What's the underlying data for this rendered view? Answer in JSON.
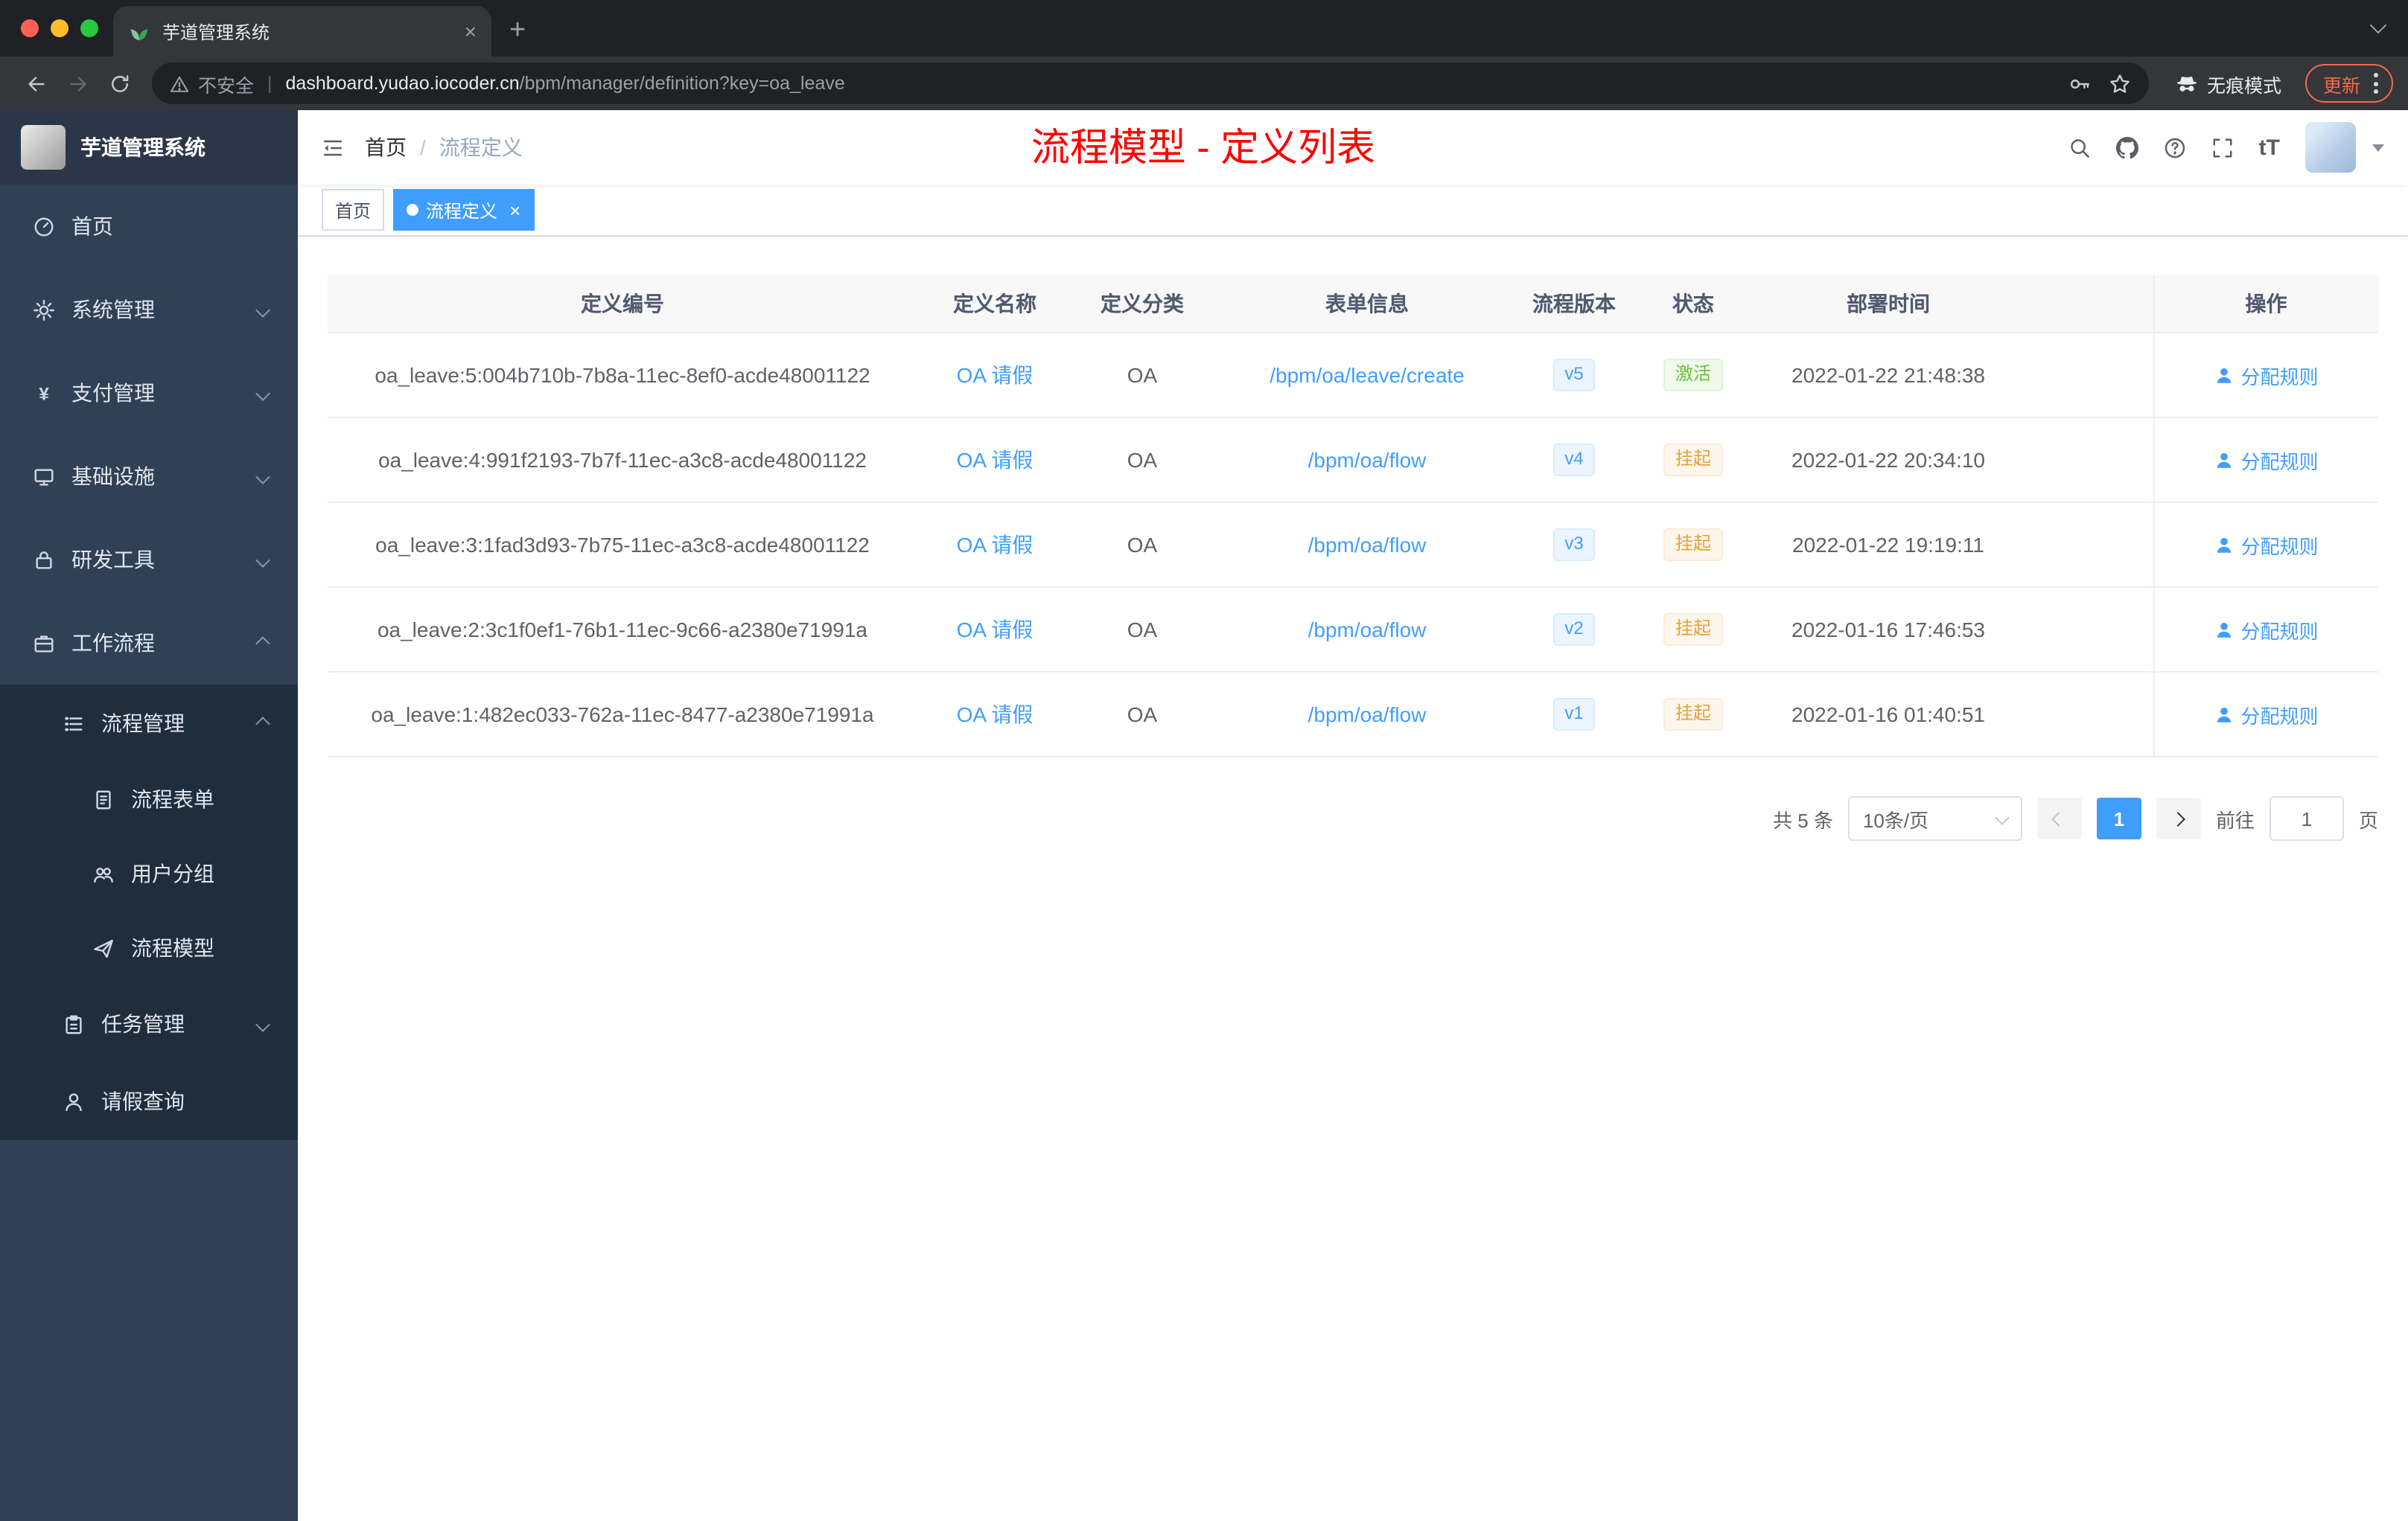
{
  "browser": {
    "tab_title": "芋道管理系统",
    "security_label": "不安全",
    "url_host": "dashboard.yudao.iocoder.cn",
    "url_path": "/bpm/manager/definition?key=oa_leave",
    "incognito_label": "无痕模式",
    "update_label": "更新"
  },
  "sidebar": {
    "logo_title": "芋道管理系统",
    "items": [
      {
        "key": "home",
        "label": "首页",
        "icon": "dashboard-icon",
        "level": 1,
        "chevron": null,
        "dark": false
      },
      {
        "key": "system",
        "label": "系统管理",
        "icon": "gear-icon",
        "level": 1,
        "chevron": "down",
        "dark": false
      },
      {
        "key": "payment",
        "label": "支付管理",
        "icon": "yen-icon",
        "level": 1,
        "chevron": "down",
        "dark": false
      },
      {
        "key": "infrastructure",
        "label": "基础设施",
        "icon": "infrastructure-icon",
        "level": 1,
        "chevron": "down",
        "dark": false
      },
      {
        "key": "devtools",
        "label": "研发工具",
        "icon": "devtools-icon",
        "level": 1,
        "chevron": "down",
        "dark": false
      },
      {
        "key": "workflow",
        "label": "工作流程",
        "icon": "workflow-icon",
        "level": 1,
        "chevron": "up",
        "dark": false
      },
      {
        "key": "process-management",
        "label": "流程管理",
        "icon": "process-management-icon",
        "level": 2,
        "chevron": "up",
        "dark": true
      },
      {
        "key": "process-form",
        "label": "流程表单",
        "icon": "form-icon",
        "level": 3,
        "chevron": null,
        "dark": true
      },
      {
        "key": "user-group",
        "label": "用户分组",
        "icon": "user-group-icon",
        "level": 3,
        "chevron": null,
        "dark": true
      },
      {
        "key": "process-model",
        "label": "流程模型",
        "icon": "model-icon",
        "level": 3,
        "chevron": null,
        "dark": true
      },
      {
        "key": "task-management",
        "label": "任务管理",
        "icon": "task-management-icon",
        "level": 2,
        "chevron": "down",
        "dark": true
      },
      {
        "key": "leave-query",
        "label": "请假查询",
        "icon": "user-icon",
        "level": 2,
        "chevron": null,
        "dark": true
      }
    ]
  },
  "header": {
    "breadcrumb_home": "首页",
    "breadcrumb_separator": "/",
    "breadcrumb_current": "流程定义",
    "title": "流程模型 - 定义列表",
    "font_size_label": "tT"
  },
  "tags": [
    {
      "label": "首页",
      "active": false,
      "closable": false
    },
    {
      "label": "流程定义",
      "active": true,
      "closable": true
    }
  ],
  "table": {
    "columns": [
      "定义编号",
      "定义名称",
      "定义分类",
      "表单信息",
      "流程版本",
      "状态",
      "部署时间",
      "操作"
    ],
    "rows": [
      {
        "id": "oa_leave:5:004b710b-7b8a-11ec-8ef0-acde48001122",
        "name": "OA 请假",
        "category": "OA",
        "form": "/bpm/oa/leave/create",
        "version": "v5",
        "status": "激活",
        "status_type": "success",
        "deploy_time": "2022-01-22 21:48:38",
        "action": "分配规则"
      },
      {
        "id": "oa_leave:4:991f2193-7b7f-11ec-a3c8-acde48001122",
        "name": "OA 请假",
        "category": "OA",
        "form": "/bpm/oa/flow",
        "version": "v4",
        "status": "挂起",
        "status_type": "warning",
        "deploy_time": "2022-01-22 20:34:10",
        "action": "分配规则"
      },
      {
        "id": "oa_leave:3:1fad3d93-7b75-11ec-a3c8-acde48001122",
        "name": "OA 请假",
        "category": "OA",
        "form": "/bpm/oa/flow",
        "version": "v3",
        "status": "挂起",
        "status_type": "warning",
        "deploy_time": "2022-01-22 19:19:11",
        "action": "分配规则"
      },
      {
        "id": "oa_leave:2:3c1f0ef1-76b1-11ec-9c66-a2380e71991a",
        "name": "OA 请假",
        "category": "OA",
        "form": "/bpm/oa/flow",
        "version": "v2",
        "status": "挂起",
        "status_type": "warning",
        "deploy_time": "2022-01-16 17:46:53",
        "action": "分配规则"
      },
      {
        "id": "oa_leave:1:482ec033-762a-11ec-8477-a2380e71991a",
        "name": "OA 请假",
        "category": "OA",
        "form": "/bpm/oa/flow",
        "version": "v1",
        "status": "挂起",
        "status_type": "warning",
        "deploy_time": "2022-01-16 01:40:51",
        "action": "分配规则"
      }
    ]
  },
  "pagination": {
    "total_text": "共 5 条",
    "page_size": "10条/页",
    "current_page": "1",
    "goto_label": "前往",
    "goto_value": "1",
    "page_suffix": "页"
  },
  "colors": {
    "accent": "#409eff",
    "success": "#67c23a",
    "warning": "#e6a23c",
    "title_red": "#ff0000",
    "sidebar_bg": "#304156",
    "submenu_bg": "#1f2d3d",
    "update_orange": "#ee6c4d"
  }
}
